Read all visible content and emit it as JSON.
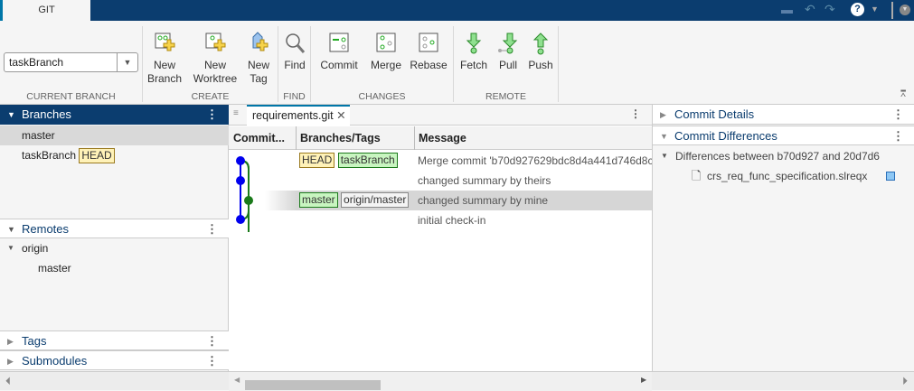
{
  "app_tab": "GIT",
  "toolstrip": {
    "current_branch": {
      "value": "taskBranch",
      "label": "CURRENT BRANCH"
    },
    "create": {
      "label": "CREATE",
      "new_branch": "New\nBranch",
      "new_worktree": "New\nWorktree",
      "new_tag": "New\nTag"
    },
    "find": {
      "label": "FIND",
      "find": "Find"
    },
    "changes": {
      "label": "CHANGES",
      "commit": "Commit",
      "merge": "Merge",
      "rebase": "Rebase"
    },
    "remote": {
      "label": "REMOTE",
      "fetch": "Fetch",
      "pull": "Pull",
      "push": "Push"
    }
  },
  "left": {
    "branches": {
      "title": "Branches",
      "items": [
        {
          "name": "master"
        },
        {
          "name": "taskBranch",
          "badge": "HEAD"
        }
      ]
    },
    "remotes": {
      "title": "Remotes",
      "origin": "origin",
      "items": [
        "master"
      ]
    },
    "tags": {
      "title": "Tags"
    },
    "submodules": {
      "title": "Submodules"
    }
  },
  "middle": {
    "tab": "requirements.git",
    "columns": [
      "Commit...",
      "Branches/Tags",
      "Message"
    ],
    "rows": [
      {
        "tags": [
          "HEAD",
          "taskBranch"
        ],
        "message": "Merge commit 'b70d927629bdc8d4a441d746d8c"
      },
      {
        "tags": [],
        "message": "changed summary by theirs"
      },
      {
        "tags": [
          "master",
          "origin/master"
        ],
        "message": "changed summary by mine"
      },
      {
        "tags": [],
        "message": "initial check-in"
      }
    ]
  },
  "right": {
    "commit_details": "Commit Details",
    "commit_differences": "Commit Differences",
    "diff_header": "Differences between b70d927 and 20d7d6",
    "files": [
      {
        "name": "crs_req_func_specification.slreqx",
        "status_color": "#8ec8f5"
      }
    ]
  },
  "colors": {
    "header_blue": "#0b3d6f",
    "graph_blue": "#0000ee",
    "graph_green": "#1a7a1a"
  }
}
